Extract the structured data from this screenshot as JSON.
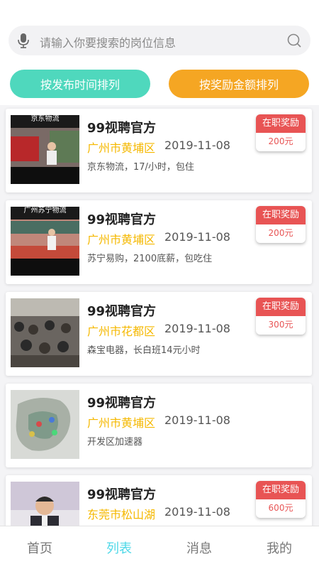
{
  "search": {
    "placeholder": "请输入你要搜索的岗位信息"
  },
  "sort": {
    "by_time": "按发布时间排列",
    "by_reward": "按奖励金额排列"
  },
  "jobs": [
    {
      "thumb_caption": "京东物流",
      "title": "99视聘官方",
      "location": "广州市黄埔区",
      "date": "2019-11-08",
      "desc": "京东物流，17/小时，包住",
      "reward_label": "在职奖励",
      "reward_amount": "200元"
    },
    {
      "thumb_caption": "广州苏宁物流",
      "title": "99视聘官方",
      "location": "广州市黄埔区",
      "date": "2019-11-08",
      "desc": "苏宁易购，2100底薪，包吃住",
      "reward_label": "在职奖励",
      "reward_amount": "200元"
    },
    {
      "thumb_caption": "",
      "title": "99视聘官方",
      "location": "广州市花都区",
      "date": "2019-11-08",
      "desc": "森宝电器，长白班14元小时",
      "reward_label": "在职奖励",
      "reward_amount": "300元"
    },
    {
      "thumb_caption": "",
      "title": "99视聘官方",
      "location": "广州市黄埔区",
      "date": "2019-11-08",
      "desc": "开发区加速器"
    },
    {
      "thumb_caption": "",
      "title": "99视聘官方",
      "location": "东莞市松山湖",
      "date": "2019-11-08",
      "desc": "",
      "reward_label": "在职奖励",
      "reward_amount": "600元"
    }
  ],
  "tabs": {
    "home": "首页",
    "list": "列表",
    "messages": "消息",
    "mine": "我的"
  },
  "colors": {
    "accent_teal": "#4fd8bd",
    "accent_orange": "#f5a623",
    "reward_red": "#e85454",
    "location_yellow": "#f5b800",
    "tab_active": "#4fd8e8"
  }
}
